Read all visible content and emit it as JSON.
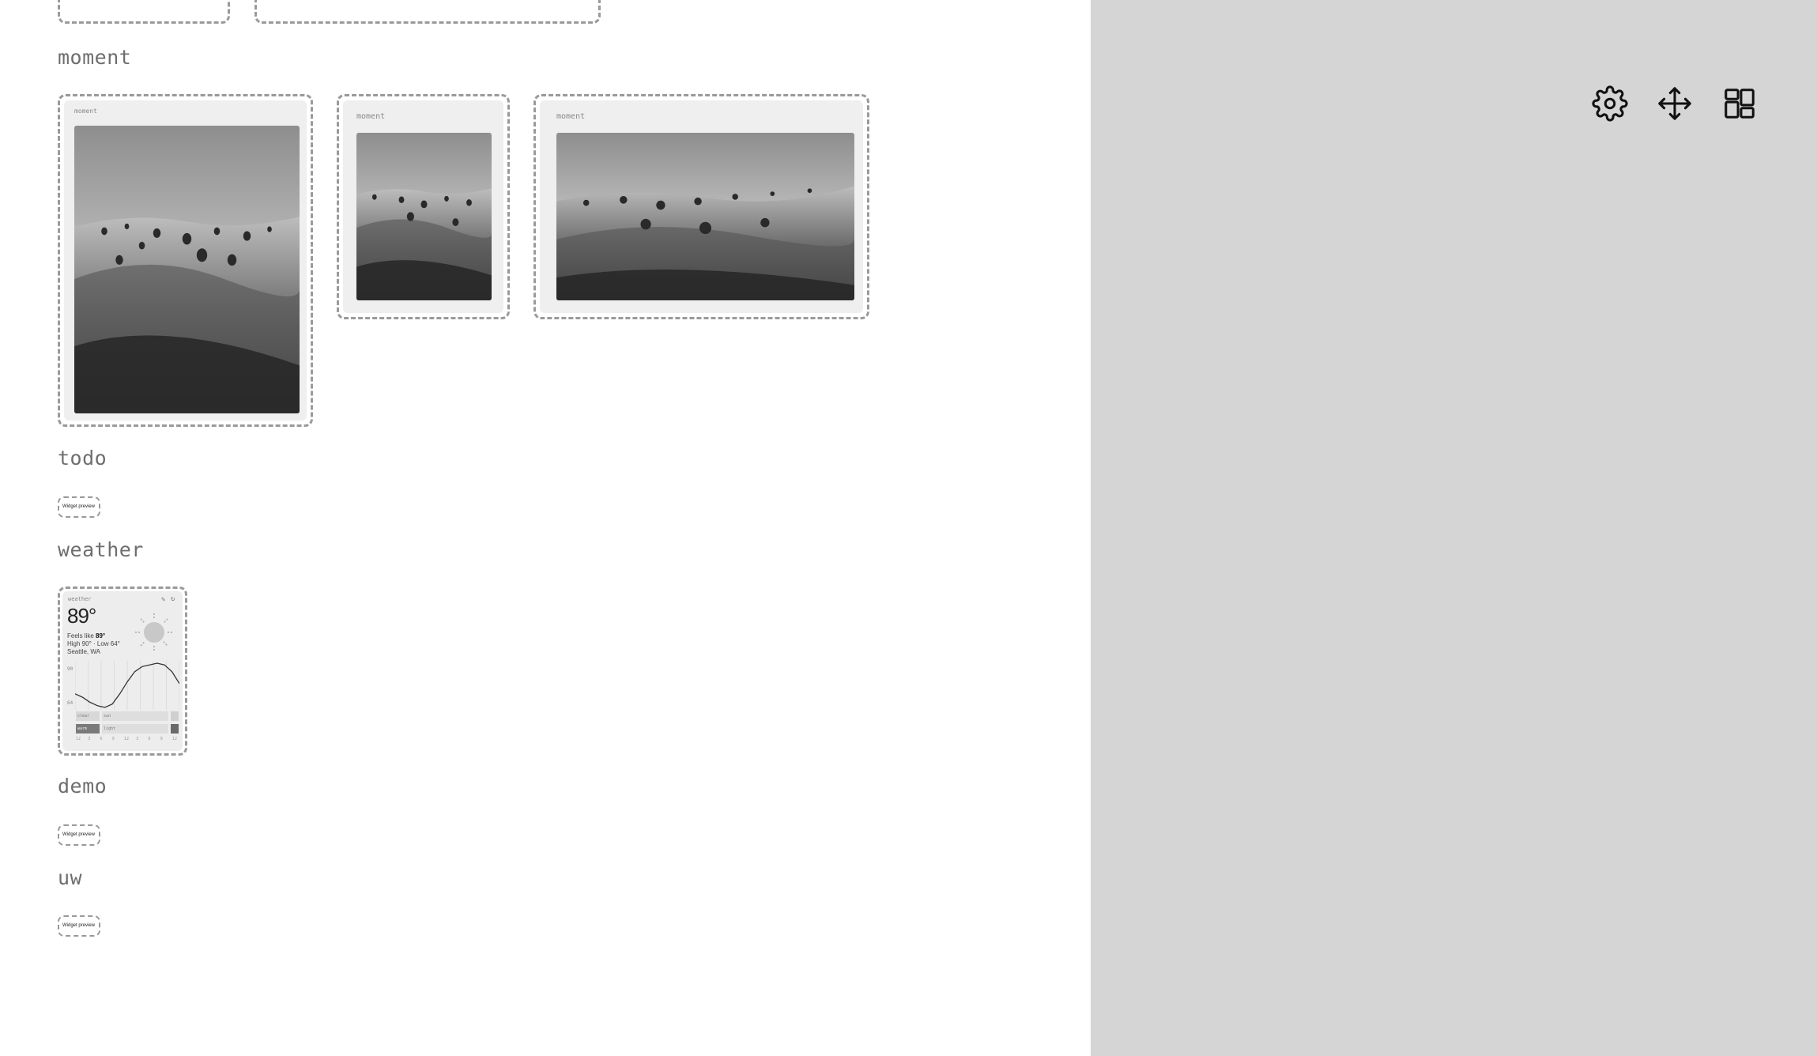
{
  "sections": {
    "moment": {
      "label": "moment"
    },
    "todo": {
      "label": "todo"
    },
    "weather": {
      "label": "weather"
    },
    "demo": {
      "label": "demo"
    },
    "uw": {
      "label": "uw"
    }
  },
  "moment_cards": [
    {
      "label": "moment",
      "photo": "grassland-hills-photo"
    },
    {
      "label": "moment",
      "photo": "grassland-hills-photo"
    },
    {
      "label": "moment",
      "photo": "grassland-hills-photo"
    }
  ],
  "mini_preview_label": "Widget preview",
  "weather_widget": {
    "label": "weather",
    "temperature": "89°",
    "feels_like_prefix": "Feels like",
    "feels_like_value": "89°",
    "high_low": "High 90° · Low 64°",
    "location": "Seattle, WA",
    "chart_high_tick": "90",
    "chart_low_tick": "64",
    "row1": [
      "clear",
      "sun"
    ],
    "row2": [
      "warm",
      "light"
    ],
    "hour_ticks": [
      "12",
      "3",
      "6",
      "9",
      "12",
      "3",
      "6",
      "9",
      "12"
    ],
    "temp_curve": [
      72,
      70,
      67,
      65,
      64,
      66,
      72,
      79,
      85,
      88,
      89,
      90,
      89,
      85,
      78
    ]
  },
  "toolbar": {
    "settings": "gear-icon",
    "move": "move-arrows-icon",
    "layout": "layout-grid-icon"
  }
}
